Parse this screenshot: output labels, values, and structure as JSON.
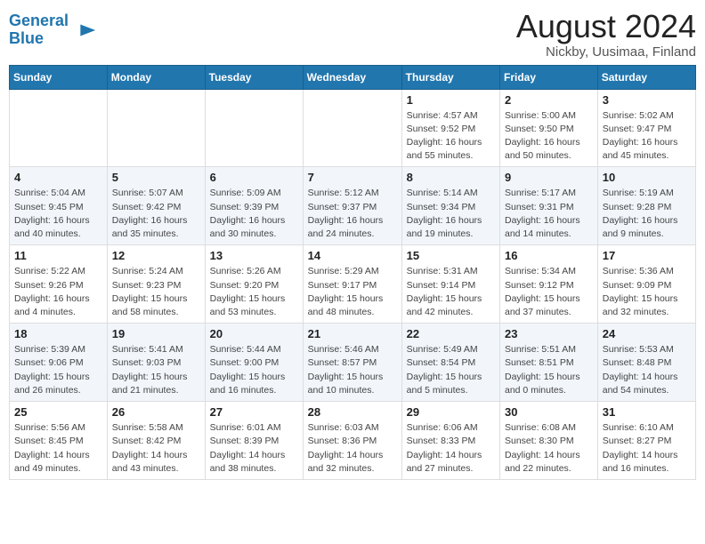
{
  "header": {
    "logo_line1": "General",
    "logo_line2": "Blue",
    "title": "August 2024",
    "subtitle": "Nickby, Uusimaa, Finland"
  },
  "weekdays": [
    "Sunday",
    "Monday",
    "Tuesday",
    "Wednesday",
    "Thursday",
    "Friday",
    "Saturday"
  ],
  "weeks": [
    [
      {
        "day": "",
        "info": ""
      },
      {
        "day": "",
        "info": ""
      },
      {
        "day": "",
        "info": ""
      },
      {
        "day": "",
        "info": ""
      },
      {
        "day": "1",
        "info": "Sunrise: 4:57 AM\nSunset: 9:52 PM\nDaylight: 16 hours\nand 55 minutes."
      },
      {
        "day": "2",
        "info": "Sunrise: 5:00 AM\nSunset: 9:50 PM\nDaylight: 16 hours\nand 50 minutes."
      },
      {
        "day": "3",
        "info": "Sunrise: 5:02 AM\nSunset: 9:47 PM\nDaylight: 16 hours\nand 45 minutes."
      }
    ],
    [
      {
        "day": "4",
        "info": "Sunrise: 5:04 AM\nSunset: 9:45 PM\nDaylight: 16 hours\nand 40 minutes."
      },
      {
        "day": "5",
        "info": "Sunrise: 5:07 AM\nSunset: 9:42 PM\nDaylight: 16 hours\nand 35 minutes."
      },
      {
        "day": "6",
        "info": "Sunrise: 5:09 AM\nSunset: 9:39 PM\nDaylight: 16 hours\nand 30 minutes."
      },
      {
        "day": "7",
        "info": "Sunrise: 5:12 AM\nSunset: 9:37 PM\nDaylight: 16 hours\nand 24 minutes."
      },
      {
        "day": "8",
        "info": "Sunrise: 5:14 AM\nSunset: 9:34 PM\nDaylight: 16 hours\nand 19 minutes."
      },
      {
        "day": "9",
        "info": "Sunrise: 5:17 AM\nSunset: 9:31 PM\nDaylight: 16 hours\nand 14 minutes."
      },
      {
        "day": "10",
        "info": "Sunrise: 5:19 AM\nSunset: 9:28 PM\nDaylight: 16 hours\nand 9 minutes."
      }
    ],
    [
      {
        "day": "11",
        "info": "Sunrise: 5:22 AM\nSunset: 9:26 PM\nDaylight: 16 hours\nand 4 minutes."
      },
      {
        "day": "12",
        "info": "Sunrise: 5:24 AM\nSunset: 9:23 PM\nDaylight: 15 hours\nand 58 minutes."
      },
      {
        "day": "13",
        "info": "Sunrise: 5:26 AM\nSunset: 9:20 PM\nDaylight: 15 hours\nand 53 minutes."
      },
      {
        "day": "14",
        "info": "Sunrise: 5:29 AM\nSunset: 9:17 PM\nDaylight: 15 hours\nand 48 minutes."
      },
      {
        "day": "15",
        "info": "Sunrise: 5:31 AM\nSunset: 9:14 PM\nDaylight: 15 hours\nand 42 minutes."
      },
      {
        "day": "16",
        "info": "Sunrise: 5:34 AM\nSunset: 9:12 PM\nDaylight: 15 hours\nand 37 minutes."
      },
      {
        "day": "17",
        "info": "Sunrise: 5:36 AM\nSunset: 9:09 PM\nDaylight: 15 hours\nand 32 minutes."
      }
    ],
    [
      {
        "day": "18",
        "info": "Sunrise: 5:39 AM\nSunset: 9:06 PM\nDaylight: 15 hours\nand 26 minutes."
      },
      {
        "day": "19",
        "info": "Sunrise: 5:41 AM\nSunset: 9:03 PM\nDaylight: 15 hours\nand 21 minutes."
      },
      {
        "day": "20",
        "info": "Sunrise: 5:44 AM\nSunset: 9:00 PM\nDaylight: 15 hours\nand 16 minutes."
      },
      {
        "day": "21",
        "info": "Sunrise: 5:46 AM\nSunset: 8:57 PM\nDaylight: 15 hours\nand 10 minutes."
      },
      {
        "day": "22",
        "info": "Sunrise: 5:49 AM\nSunset: 8:54 PM\nDaylight: 15 hours\nand 5 minutes."
      },
      {
        "day": "23",
        "info": "Sunrise: 5:51 AM\nSunset: 8:51 PM\nDaylight: 15 hours\nand 0 minutes."
      },
      {
        "day": "24",
        "info": "Sunrise: 5:53 AM\nSunset: 8:48 PM\nDaylight: 14 hours\nand 54 minutes."
      }
    ],
    [
      {
        "day": "25",
        "info": "Sunrise: 5:56 AM\nSunset: 8:45 PM\nDaylight: 14 hours\nand 49 minutes."
      },
      {
        "day": "26",
        "info": "Sunrise: 5:58 AM\nSunset: 8:42 PM\nDaylight: 14 hours\nand 43 minutes."
      },
      {
        "day": "27",
        "info": "Sunrise: 6:01 AM\nSunset: 8:39 PM\nDaylight: 14 hours\nand 38 minutes."
      },
      {
        "day": "28",
        "info": "Sunrise: 6:03 AM\nSunset: 8:36 PM\nDaylight: 14 hours\nand 32 minutes."
      },
      {
        "day": "29",
        "info": "Sunrise: 6:06 AM\nSunset: 8:33 PM\nDaylight: 14 hours\nand 27 minutes."
      },
      {
        "day": "30",
        "info": "Sunrise: 6:08 AM\nSunset: 8:30 PM\nDaylight: 14 hours\nand 22 minutes."
      },
      {
        "day": "31",
        "info": "Sunrise: 6:10 AM\nSunset: 8:27 PM\nDaylight: 14 hours\nand 16 minutes."
      }
    ]
  ]
}
